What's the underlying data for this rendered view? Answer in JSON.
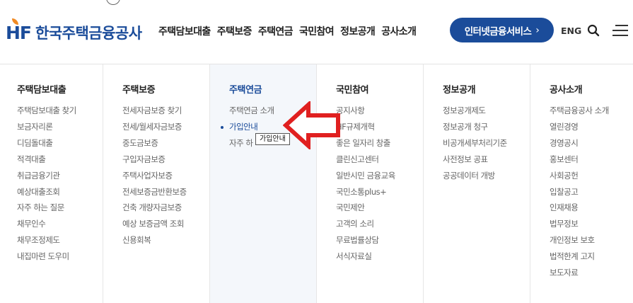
{
  "logo": {
    "mark": "HF",
    "name": "한국주택금융공사"
  },
  "gnb": {
    "items": [
      "주택담보대출",
      "주택보증",
      "주택연금",
      "국민참여",
      "정보공개",
      "공사소개"
    ]
  },
  "header": {
    "internet_label": "인터넷금융서비스",
    "internet_chevron": "›",
    "eng_label": "ENG"
  },
  "mega": {
    "columns": [
      {
        "title": "주택담보대출",
        "items": [
          "주택담보대출 찾기",
          "보금자리론",
          "디딤돌대출",
          "적격대출",
          "취급금융기관",
          "예상대출조회",
          "자주 하는 질문",
          "채무인수",
          "채무조정제도",
          "내집마련 도우미"
        ]
      },
      {
        "title": "주택보증",
        "items": [
          "전세자금보증 찾기",
          "전세/월세자금보증",
          "중도금보증",
          "구입자금보증",
          "주택사업자보증",
          "전세보증금반환보증",
          "건축 개량자금보증",
          "예상 보증금액 조회",
          "신용회복"
        ]
      },
      {
        "title": "주택연금",
        "items": [
          "주택연금 소개",
          "가입안내",
          "자주 하"
        ]
      },
      {
        "title": "국민참여",
        "items": [
          "공지사항",
          "HF규제개혁",
          "좋은 일자리 창출",
          "클린신고센터",
          "일반시민 금융교육",
          "국민소통plus+",
          "국민제안",
          "고객의 소리",
          "무료법률상담",
          "서식자료실"
        ]
      },
      {
        "title": "정보공개",
        "items": [
          "정보공개제도",
          "정보공개 청구",
          "비공개세부처리기준",
          "사전정보 공표",
          "공공데이터 개방"
        ]
      },
      {
        "title": "공사소개",
        "items": [
          "주택금융공사 소개",
          "열린경영",
          "경영공시",
          "홍보센터",
          "사회공헌",
          "입찰공고",
          "인재채용",
          "법무정보",
          "개인정보 보호",
          "법적한계 고지",
          "보도자료"
        ]
      }
    ],
    "tooltip": "가입안내"
  },
  "colors": {
    "brand": "#1b4c9a",
    "accent": "#f08a24",
    "arrow": "#e02020"
  },
  "icons": {
    "search": "search-icon",
    "menu": "hamburger-menu-icon",
    "arrow": "red-arrow-annotation"
  }
}
